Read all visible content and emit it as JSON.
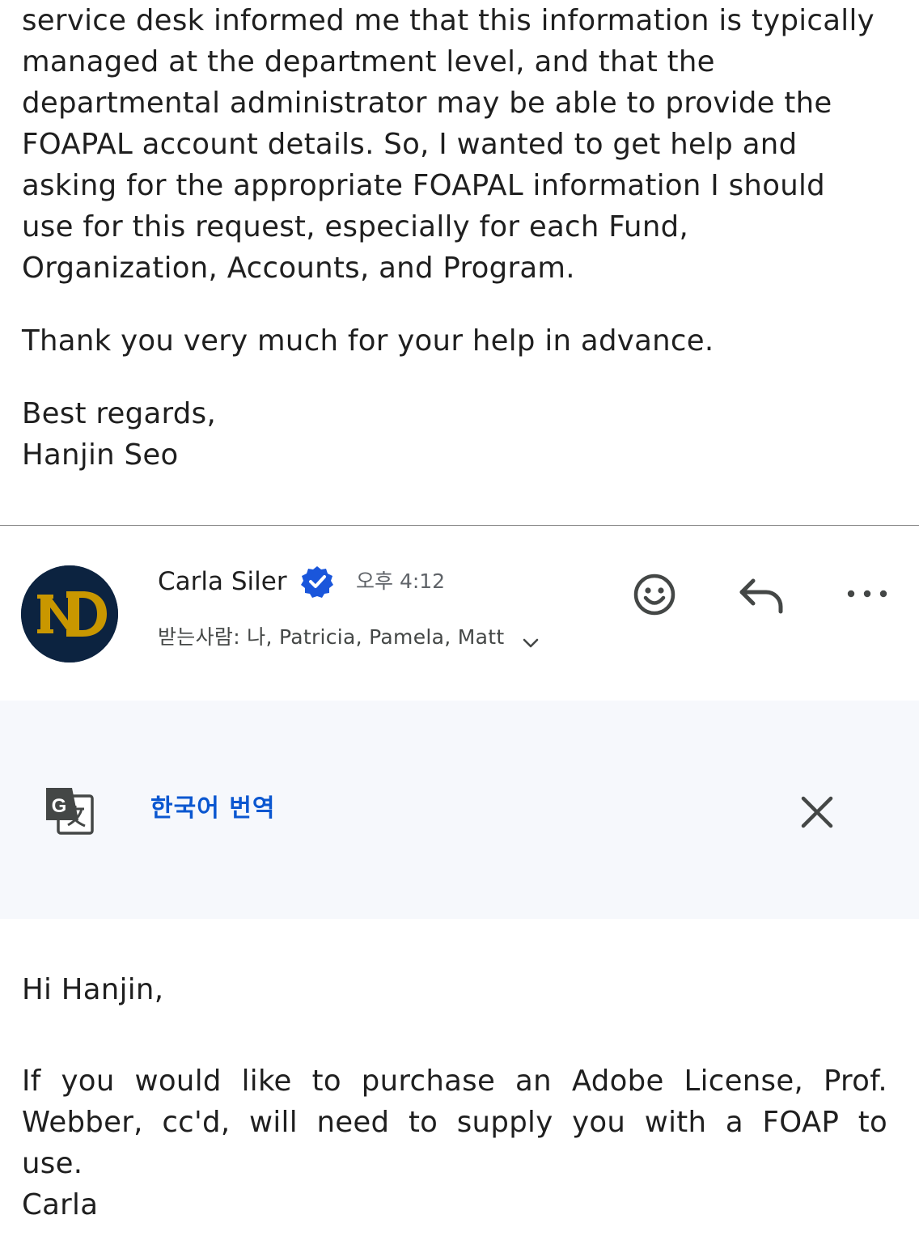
{
  "previous_message": {
    "paragraph_lines": [
      "service desk informed me that this information is typically",
      "managed at the department level, and that the",
      "departmental administrator may be able to provide the",
      "FOAPAL account details. So, I wanted to get help and",
      "asking for the appropriate FOAPAL information I should",
      "use for this request, especially for each Fund,",
      "Organization, Accounts, and Program."
    ],
    "thanks": "Thank you very much for your help in advance.",
    "closing": "Best regards,",
    "signature": "Hanjin Seo"
  },
  "reply_header": {
    "sender_name": "Carla Siler",
    "verified_icon": "verified-badge-icon",
    "time": "오후 4:12",
    "recipients": "받는사람: 나, Patricia, Pamela, Matt",
    "avatar_label": "ND",
    "actions": {
      "emoji_icon": "emoji-reaction-icon",
      "reply_icon": "reply-icon",
      "more_icon": "more-options-icon"
    }
  },
  "translate_bar": {
    "icon": "google-translate-icon",
    "link_text": "한국어 번역",
    "close_icon": "close-icon"
  },
  "reply_message": {
    "greeting": "Hi Hanjin,",
    "body_lines": [
      "If you would like to purchase an Adobe License, Prof.",
      "Webber, cc'd, will need to supply you with a FOAP to",
      "use."
    ],
    "signature": "Carla"
  },
  "colors": {
    "link_blue": "#0b57d0",
    "verified_blue": "#1a56db",
    "translate_bg": "#f6f8fc",
    "avatar_navy": "#0c2340",
    "avatar_gold": "#c99700"
  }
}
